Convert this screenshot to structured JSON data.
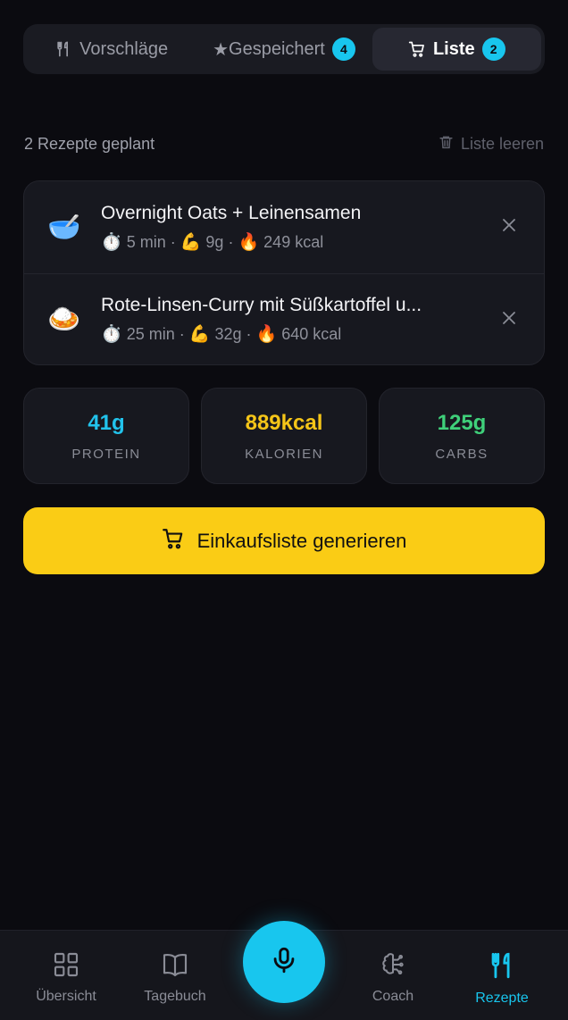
{
  "tabs": [
    {
      "label": "Vorschläge",
      "icon": "fork-knife-icon"
    },
    {
      "label": "Gespeichert",
      "icon": "star-icon",
      "badge": "4"
    },
    {
      "label": "Liste",
      "icon": "cart-icon",
      "badge": "2",
      "active": true
    }
  ],
  "summary": {
    "planned": "2 Rezepte geplant",
    "clear_label": "Liste leeren"
  },
  "recipes": [
    {
      "emoji": "🥣",
      "name": "Overnight Oats + Leinensamen",
      "time": "5 min",
      "protein": "9g",
      "kcal": "249 kcal"
    },
    {
      "emoji": "🍛",
      "name": "Rote-Linsen-Curry mit Süßkartoffel u...",
      "time": "25 min",
      "protein": "32g",
      "kcal": "640 kcal"
    }
  ],
  "meta_emoji": {
    "time": "⏱️",
    "protein": "💪",
    "kcal": "🔥",
    "sep": "·"
  },
  "stats": [
    {
      "value": "41g",
      "label": "PROTEIN",
      "color": "#22c3ec"
    },
    {
      "value": "889kcal",
      "label": "KALORIEN",
      "color": "#f5c518"
    },
    {
      "value": "125g",
      "label": "CARBS",
      "color": "#3fd07a"
    }
  ],
  "cta": {
    "label": "Einkaufsliste generieren"
  },
  "nav": [
    {
      "label": "Übersicht",
      "icon": "grid-icon"
    },
    {
      "label": "Tagebuch",
      "icon": "book-icon"
    },
    {
      "label": "Coach",
      "icon": "brain-icon"
    },
    {
      "label": "Rezepte",
      "icon": "fork-knife-icon",
      "active": true
    }
  ],
  "colors": {
    "accent": "#18c6ee",
    "cta": "#facc15",
    "background": "#0b0b10"
  }
}
